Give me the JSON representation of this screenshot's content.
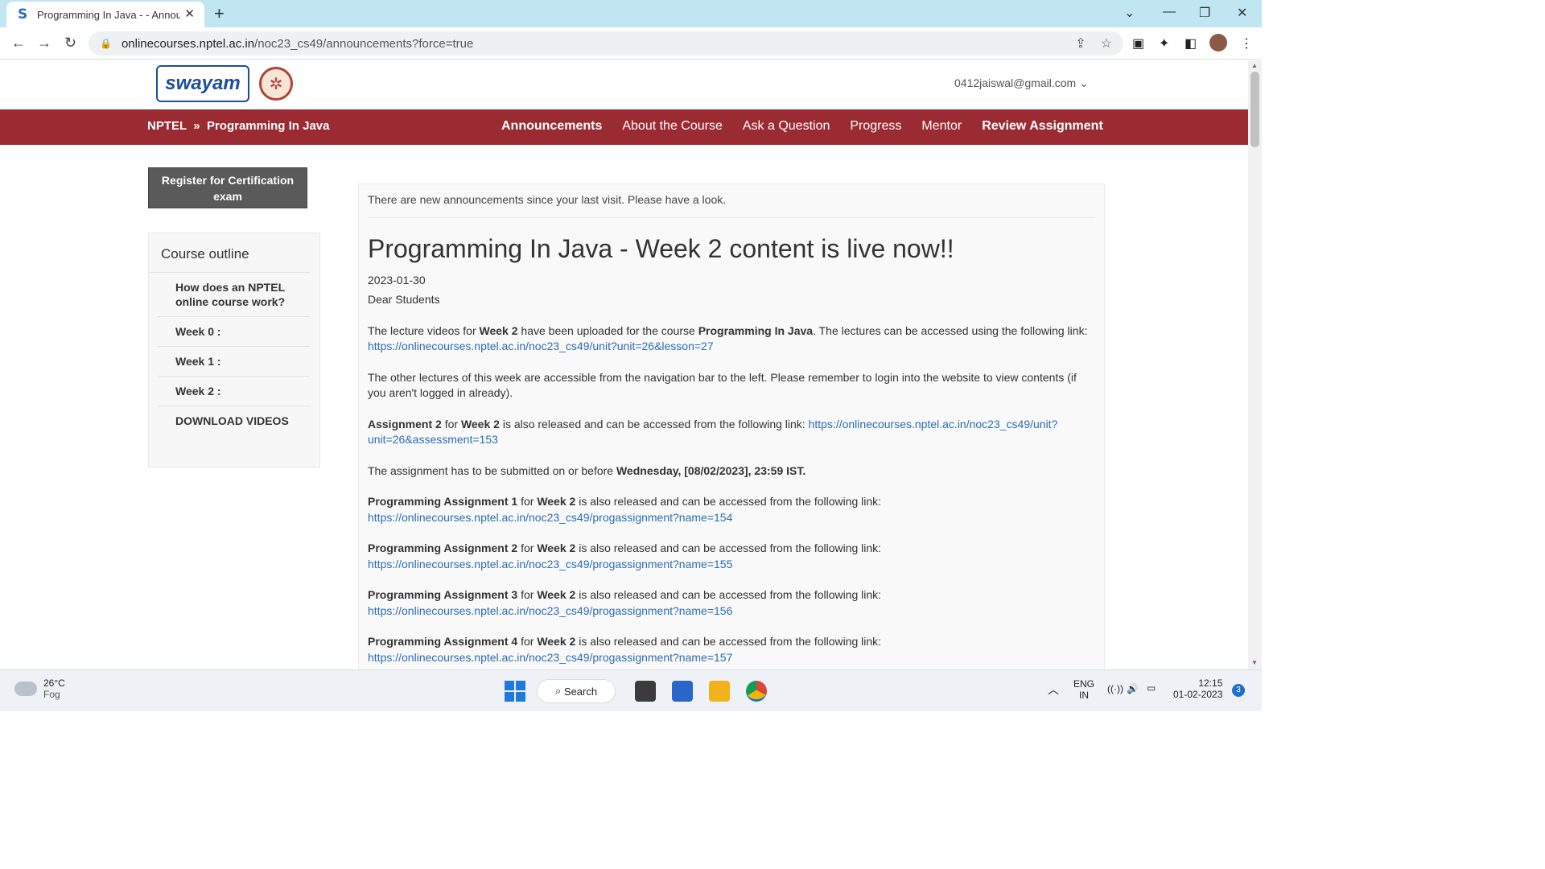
{
  "browser": {
    "tab_title": "Programming In Java - - Announcements",
    "tab_favicon": "S",
    "url_host": "onlinecourses.nptel.ac.in",
    "url_path": "/noc23_cs49/announcements?force=true"
  },
  "site": {
    "logo_text": "swayam",
    "user_email": "0412jaiswal@gmail.com",
    "breadcrumb_root": "NPTEL",
    "breadcrumb_sep": "»",
    "breadcrumb_course": "Programming In Java",
    "nav": {
      "announcements": "Announcements",
      "about": "About the Course",
      "ask": "Ask a Question",
      "progress": "Progress",
      "mentor": "Mentor",
      "review": "Review Assignment"
    }
  },
  "sidebar": {
    "register_label": "Register for Certification exam",
    "outline_title": "Course outline",
    "items": [
      "How does an NPTEL online course work?",
      "Week 0 :",
      "Week 1 :",
      "Week 2 :",
      "DOWNLOAD VIDEOS"
    ]
  },
  "announcement": {
    "notice": "There are new announcements since your last visit. Please have a look.",
    "title": "Programming In Java - Week 2 content is live now!!",
    "date": "2023-01-30",
    "greeting": "Dear Students",
    "p1_a": "The lecture videos for ",
    "p1_b": "Week 2",
    "p1_c": " have been uploaded for the course ",
    "p1_d": "Programming In Java",
    "p1_e": ". The lectures can be accessed using the following link:",
    "p1_link": "https://onlinecourses.nptel.ac.in/noc23_cs49/unit?unit=26&lesson=27",
    "p2": "The other lectures of this week are accessible from the navigation bar to the left. Please remember to login into the website to view contents (if you aren't logged in already).",
    "p3_a": "Assignment 2",
    "p3_b": " for ",
    "p3_c": "Week 2",
    "p3_d": " is also released and can be accessed from the following link: ",
    "p3_link_1": "https://onlinecourses.nptel.ac.in/noc23_cs49/unit?",
    "p3_link_2": "unit=26&assessment=153",
    "p4_a": "The assignment has to be submitted on or before ",
    "p4_b": "Wednesday, [08/02/2023], 23:59 IST.",
    "pa_for": " for ",
    "pa_week": "Week 2",
    "pa_rest": " is also released and can be accessed from the following link:",
    "prog": [
      {
        "label": "Programming Assignment 1",
        "link": "https://onlinecourses.nptel.ac.in/noc23_cs49/progassignment?name=154"
      },
      {
        "label": "Programming Assignment 2",
        "link": "https://onlinecourses.nptel.ac.in/noc23_cs49/progassignment?name=155"
      },
      {
        "label": "Programming Assignment 3",
        "link": "https://onlinecourses.nptel.ac.in/noc23_cs49/progassignment?name=156"
      },
      {
        "label": "Programming Assignment 4",
        "link": "https://onlinecourses.nptel.ac.in/noc23_cs49/progassignment?name=157"
      }
    ]
  },
  "taskbar": {
    "temp": "26°C",
    "weather": "Fog",
    "search_label": "Search",
    "lang_1": "ENG",
    "lang_2": "IN",
    "time": "12:15",
    "date": "01-02-2023",
    "notif_count": "3"
  },
  "colors": {
    "navbar": "#9b2b33",
    "link": "#2a6db5",
    "tabbar": "#bfe6f1"
  }
}
